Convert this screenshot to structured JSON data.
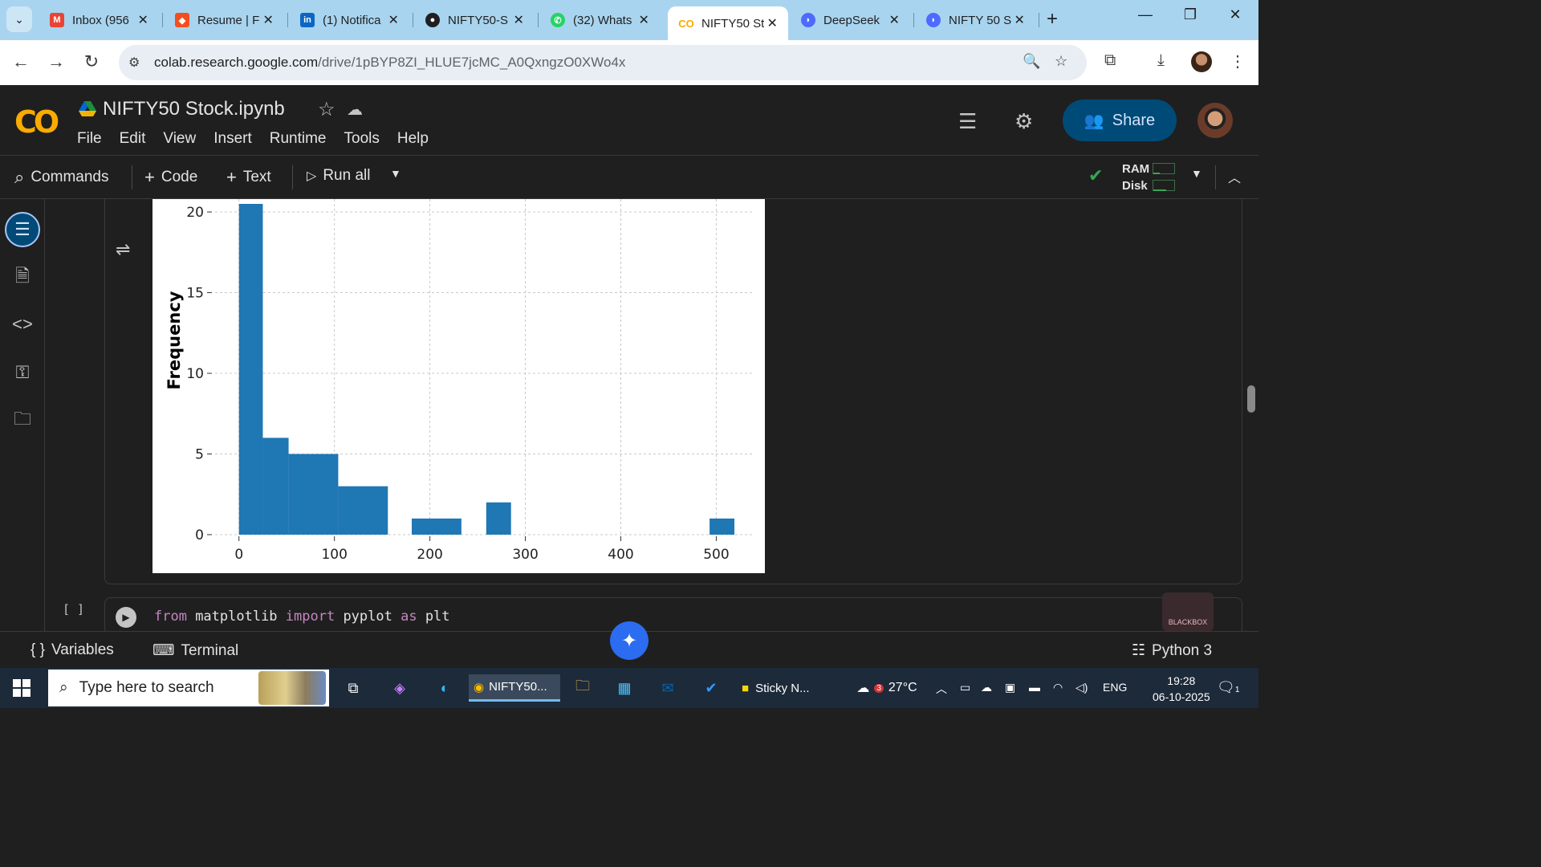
{
  "browser": {
    "tabs": [
      {
        "title": "Inbox (956",
        "icon": "gmail-icon",
        "color": "#ea4335"
      },
      {
        "title": "Resume | F",
        "icon": "figma-icon",
        "color": "#f24e1e"
      },
      {
        "title": "(1) Notifica",
        "icon": "linkedin-icon",
        "color": "#0a66c2"
      },
      {
        "title": "NIFTY50-S",
        "icon": "github-icon",
        "color": "#1f1f1f"
      },
      {
        "title": "(32) Whats",
        "icon": "whatsapp-icon",
        "color": "#25d366"
      },
      {
        "title": "NIFTY50 St",
        "icon": "colab-icon",
        "color": "#f9ab00"
      },
      {
        "title": "DeepSeek",
        "icon": "deepseek-icon",
        "color": "#4d6bfe"
      },
      {
        "title": "NIFTY 50 S",
        "icon": "deepseek-icon",
        "color": "#4d6bfe"
      }
    ],
    "url_host": "colab.research.google.com",
    "url_path": "/drive/1pBYP8ZI_HLUE7jcMC_A0QxngzO0XWo4x"
  },
  "colab": {
    "logo": "CO",
    "notebook_title": "NIFTY50 Stock.ipynb",
    "menu": [
      "File",
      "Edit",
      "View",
      "Insert",
      "Runtime",
      "Tools",
      "Help"
    ],
    "share_label": "Share",
    "toolbar": {
      "commands": "Commands",
      "code": "Code",
      "text": "Text",
      "run_all": "Run all",
      "ram": "RAM",
      "disk": "Disk"
    },
    "next_cell": {
      "exec_count": "[ ]",
      "code_from": "from",
      "code_mod": " matplotlib ",
      "code_import": "import",
      "code_name": " pyplot ",
      "code_as": "as",
      "code_alias": " plt"
    },
    "statusbar": {
      "variables": "Variables",
      "terminal": "Terminal",
      "kernel": "Python 3"
    },
    "blackbox_label": "BLACKBOX"
  },
  "chart_data": {
    "type": "bar",
    "ylabel": "Frequency",
    "xlabel": "",
    "xticks": [
      0,
      100,
      200,
      300,
      400,
      500
    ],
    "yticks": [
      0,
      5,
      10,
      15,
      20
    ],
    "xlim": [
      -25,
      540
    ],
    "ylim": [
      0,
      20.5
    ],
    "grid": true,
    "bar_color": "#1f77b4",
    "bins": [
      {
        "x0": 0,
        "x1": 25,
        "value": 20.5
      },
      {
        "x0": 25,
        "x1": 52,
        "value": 6
      },
      {
        "x0": 52,
        "x1": 104,
        "value": 5
      },
      {
        "x0": 104,
        "x1": 156,
        "value": 3
      },
      {
        "x0": 181,
        "x1": 233,
        "value": 1
      },
      {
        "x0": 259,
        "x1": 285,
        "value": 2
      },
      {
        "x0": 493,
        "x1": 519,
        "value": 1
      }
    ]
  },
  "taskbar": {
    "search_placeholder": "Type here to search",
    "chrome_label": "NIFTY50...",
    "sticky_label": "Sticky N...",
    "weather": "27°C",
    "weather_badge": "3",
    "lang": "ENG",
    "time": "19:28",
    "date": "06-10-2025",
    "notif_count": "1"
  }
}
